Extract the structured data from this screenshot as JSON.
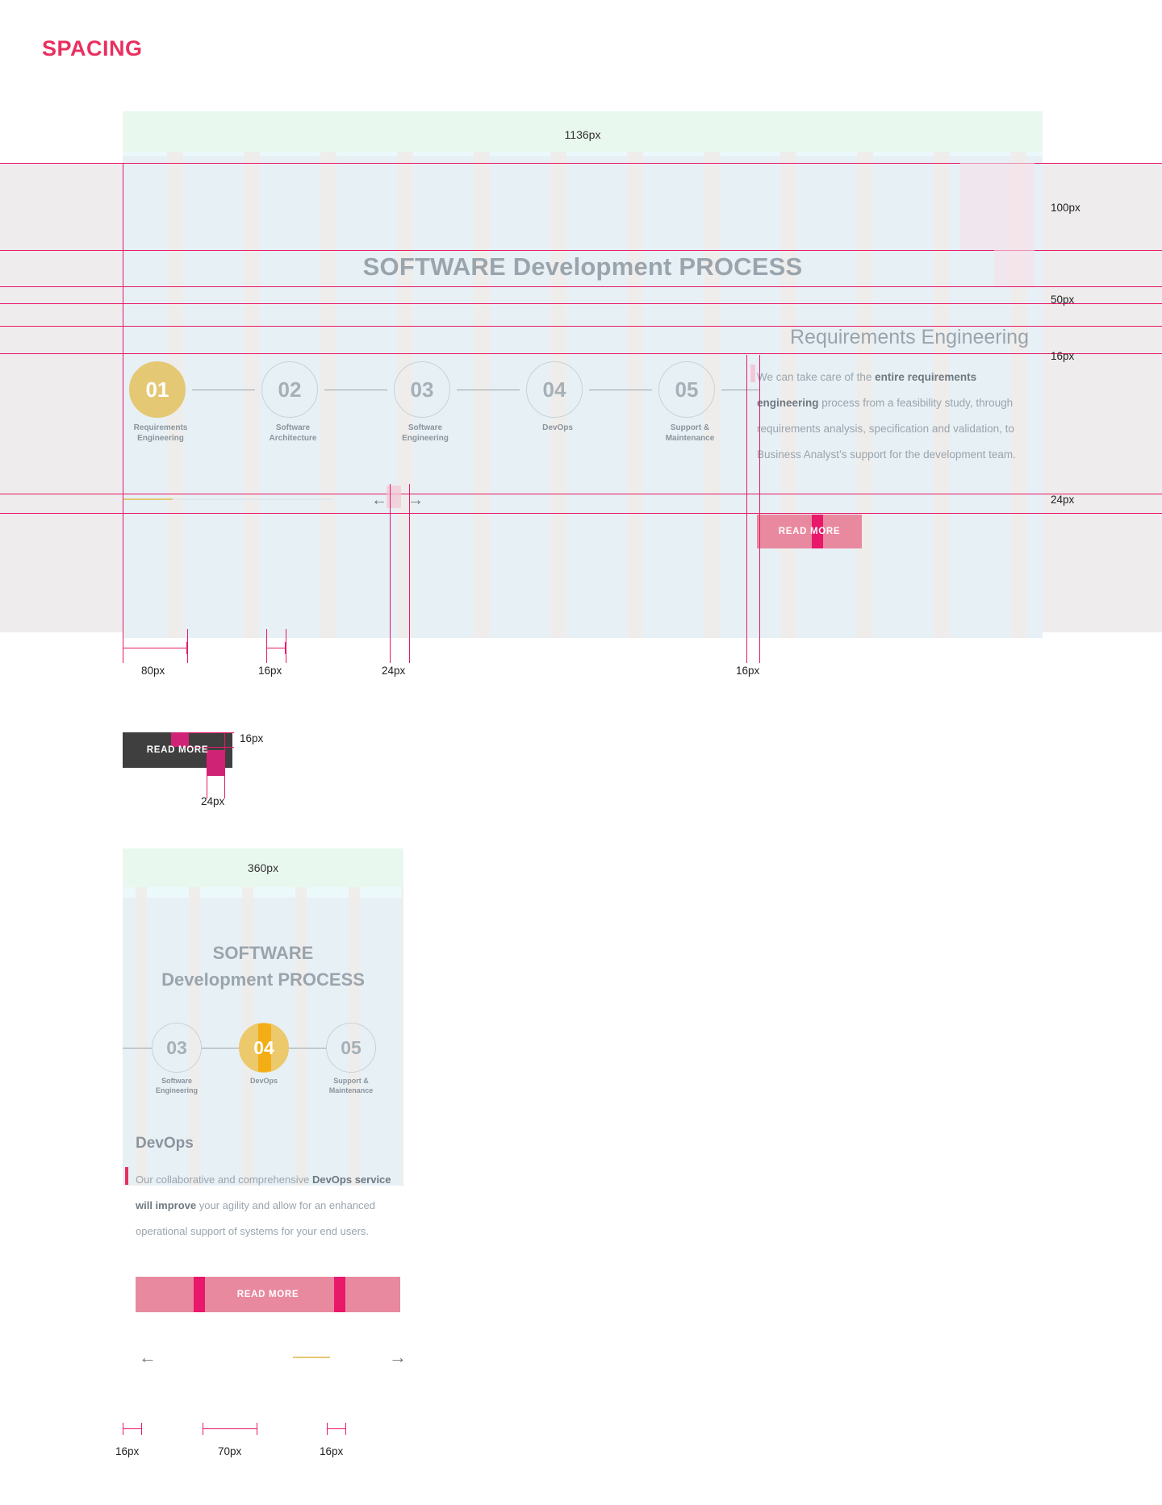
{
  "page": {
    "title": "SPACING",
    "accent_color": "#e8305f"
  },
  "desktop": {
    "width_label": "1136px",
    "heading": "SOFTWARE Development PROCESS",
    "subheading": "Requirements Engineering",
    "right_markers": [
      "100px",
      "50px",
      "16px",
      "24px"
    ],
    "steps": [
      {
        "number": "01",
        "label": "Requirements\nEngineering",
        "label_line1": "Requirements",
        "label_line2": "Engineering",
        "active": true
      },
      {
        "number": "02",
        "label_line1": "Software",
        "label_line2": "Architecture",
        "active": false
      },
      {
        "number": "03",
        "label_line1": "Software",
        "label_line2": "Engineering",
        "active": false
      },
      {
        "number": "04",
        "label_line1": "DevOps",
        "label_line2": "",
        "active": false
      },
      {
        "number": "05",
        "label_line1": "Support &",
        "label_line2": "Maintenance",
        "active": false
      }
    ],
    "body_pre": "We can take care of the ",
    "body_bold": "entire requirements engineering",
    "body_post": " process from a feasibility study, through requirements analysis, specification and validation, to Business Analyst’s support for the development team.",
    "read_more": "READ MORE",
    "arrow_left": "←",
    "arrow_right": "→",
    "bottom_measures": [
      "80px",
      "16px",
      "24px",
      "16px"
    ]
  },
  "button_detail": {
    "label": "READ MORE",
    "pad_vertical": "16px",
    "pad_horizontal": "24px"
  },
  "mobile": {
    "width_label": "360px",
    "heading_line1": "SOFTWARE",
    "heading_line2": "Development PROCESS",
    "steps": [
      {
        "number": "03",
        "label_line1": "Software",
        "label_line2": "Engineering",
        "active": false
      },
      {
        "number": "04",
        "label_line1": "DevOps",
        "label_line2": "",
        "active": true
      },
      {
        "number": "05",
        "label_line1": "Support &",
        "label_line2": "Maintenance",
        "active": false
      }
    ],
    "section_title": "DevOps",
    "body_pre": "Our collaborative and comprehensive ",
    "body_bold": "DevOps service will improve",
    "body_post": " your agility and allow for an enhanced operational support of systems for your end users.",
    "read_more": "READ MORE",
    "arrow_left": "←",
    "arrow_right": "→",
    "bottom_measures": [
      "16px",
      "70px",
      "16px"
    ]
  }
}
